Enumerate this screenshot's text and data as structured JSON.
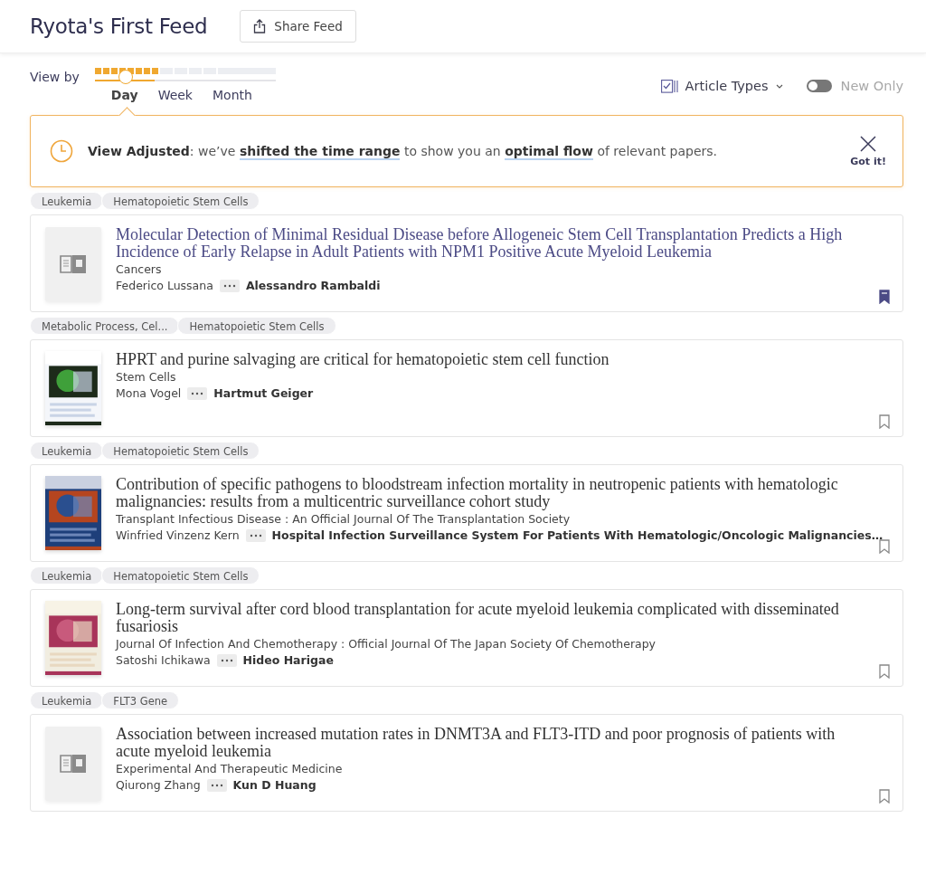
{
  "header": {
    "title": "Ryota's First Feed",
    "share_button": "Share Feed"
  },
  "view_by": {
    "label": "View by",
    "level": 0.17,
    "tabs": [
      {
        "label": "Day",
        "selected": true
      },
      {
        "label": "Week",
        "selected": false
      },
      {
        "label": "Month",
        "selected": false
      }
    ]
  },
  "filters": {
    "article_types": "Article Types",
    "new_only": {
      "label": "New Only",
      "on": false
    }
  },
  "notice": {
    "message": "**View Adjusted**: we’ve **shifted the time range** to show you an **optimal flow** of relevant papers.",
    "dismiss": "Got it!"
  },
  "articles": [
    {
      "tags": [
        "Leukemia",
        "Hematopoietic Stem Cells"
      ],
      "cover": {
        "kind": "placeholder"
      },
      "title": "Molecular Detection of Minimal Residual Disease before Allogeneic Stem Cell Transplantation Predicts a High Incidence of Early Relapse in Adult Patients with NPM1 Positive Acute Myeloid Leukemia",
      "visited": true,
      "journal": "Cancers",
      "first_author": "Federico Lussana",
      "last_author": "Alessandro Rambaldi",
      "saved": true
    },
    {
      "tags": [
        "Metabolic Process, Cel...",
        "Hematopoietic Stem Cells"
      ],
      "cover": {
        "kind": "picture"
      },
      "title": "HPRT and purine salvaging are critical for hematopoietic stem cell function",
      "visited": false,
      "journal": "Stem Cells",
      "first_author": "Mona Vogel",
      "last_author": "Hartmut Geiger",
      "saved": false
    },
    {
      "tags": [
        "Leukemia",
        "Hematopoietic Stem Cells"
      ],
      "cover": {
        "kind": "picture"
      },
      "title": "Contribution of specific pathogens to bloodstream infection mortality in neutropenic patients with hematologic malignancies: results from a multicentric surveillance cohort study",
      "visited": false,
      "journal": "Transplant Infectious Disease : An Official Journal Of The Transplantation Society",
      "first_author": "Winfried Vinzenz Kern",
      "last_author": "Hospital Infection Surveillance System For Patients With Hematologic/Oncologic Malignancies…",
      "saved": false
    },
    {
      "tags": [
        "Leukemia",
        "Hematopoietic Stem Cells"
      ],
      "cover": {
        "kind": "picture"
      },
      "title": "Long-term survival after cord blood transplantation for acute myeloid leukemia complicated with disseminated fusariosis",
      "visited": false,
      "journal": "Journal Of Infection And Chemotherapy : Official Journal Of The Japan Society Of Chemotherapy",
      "first_author": "Satoshi Ichikawa",
      "last_author": "Hideo Harigae",
      "saved": false
    },
    {
      "tags": [
        "Leukemia",
        "FLT3 Gene"
      ],
      "cover": {
        "kind": "placeholder"
      },
      "title": "Association between increased mutation rates in DNMT3A and FLT3-ITD and poor prognosis of patients with acute myeloid leukemia",
      "visited": false,
      "journal": "Experimental And Therapeutic Medicine",
      "first_author": "Qiurong Zhang",
      "last_author": "Kun D Huang",
      "saved": false
    }
  ]
}
